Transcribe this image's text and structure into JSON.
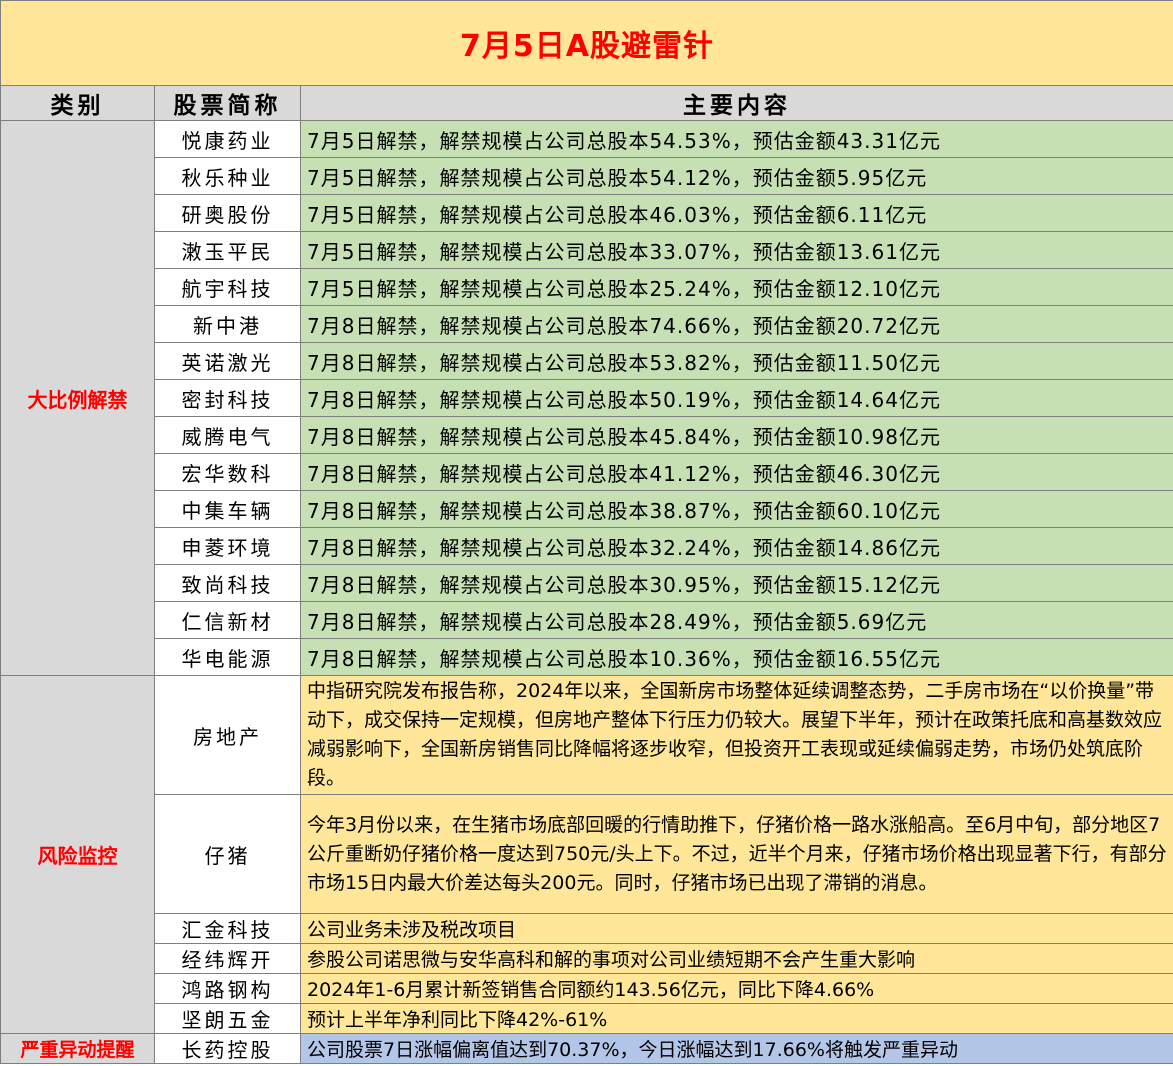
{
  "title": "7月5日A股避雷针",
  "headers": {
    "category": "类别",
    "stock": "股票简称",
    "content": "主要内容"
  },
  "sections": {
    "unlock": {
      "category": "大比例解禁",
      "rows": [
        {
          "name": "悦康药业",
          "content": "7月5日解禁，解禁规模占公司总股本54.53%，预估金额43.31亿元"
        },
        {
          "name": "秋乐种业",
          "content": "7月5日解禁，解禁规模占公司总股本54.12%，预估金额5.95亿元"
        },
        {
          "name": "研奥股份",
          "content": "7月5日解禁，解禁规模占公司总股本46.03%，预估金额6.11亿元"
        },
        {
          "name": "潄玉平民",
          "content": "7月5日解禁，解禁规模占公司总股本33.07%，预估金额13.61亿元"
        },
        {
          "name": "航宇科技",
          "content": "7月5日解禁，解禁规模占公司总股本25.24%，预估金额12.10亿元"
        },
        {
          "name": "新中港",
          "content": "7月8日解禁，解禁规模占公司总股本74.66%，预估金额20.72亿元"
        },
        {
          "name": "英诺激光",
          "content": "7月8日解禁，解禁规模占公司总股本53.82%，预估金额11.50亿元"
        },
        {
          "name": "密封科技",
          "content": "7月8日解禁，解禁规模占公司总股本50.19%，预估金额14.64亿元"
        },
        {
          "name": "威腾电气",
          "content": "7月8日解禁，解禁规模占公司总股本45.84%，预估金额10.98亿元"
        },
        {
          "name": "宏华数科",
          "content": "7月8日解禁，解禁规模占公司总股本41.12%，预估金额46.30亿元"
        },
        {
          "name": "中集车辆",
          "content": "7月8日解禁，解禁规模占公司总股本38.87%，预估金额60.10亿元"
        },
        {
          "name": "申菱环境",
          "content": "7月8日解禁，解禁规模占公司总股本32.24%，预估金额14.86亿元"
        },
        {
          "name": "致尚科技",
          "content": "7月8日解禁，解禁规模占公司总股本30.95%，预估金额15.12亿元"
        },
        {
          "name": "仁信新材",
          "content": "7月8日解禁，解禁规模占公司总股本28.49%，预估金额5.69亿元"
        },
        {
          "name": "华电能源",
          "content": "7月8日解禁，解禁规模占公司总股本10.36%，预估金额16.55亿元"
        }
      ]
    },
    "risk": {
      "category": "风险监控",
      "rows": [
        {
          "name": "房地产",
          "content": "中指研究院发布报告称，2024年以来，全国新房市场整体延续调整态势，二手房市场在“以价换量”带动下，成交保持一定规模，但房地产整体下行压力仍较大。展望下半年，预计在政策托底和高基数效应减弱影响下，全国新房销售同比降幅将逐步收窄，但投资开工表现或延续偏弱走势，市场仍处筑底阶段。"
        },
        {
          "name": "仔猪",
          "content": "今年3月份以来，在生猪市场底部回暖的行情助推下，仔猪价格一路水涨船高。至6月中旬，部分地区7公斤重断奶仔猪价格一度达到750元/头上下。不过，近半个月来，仔猪市场价格出现显著下行，有部分市场15日内最大价差达每头200元。同时，仔猪市场已出现了滞销的消息。"
        },
        {
          "name": "汇金科技",
          "content": "公司业务未涉及税改项目"
        },
        {
          "name": "经纬辉开",
          "content": "参股公司诺思微与安华高科和解的事项对公司业绩短期不会产生重大影响"
        },
        {
          "name": "鸿路钢构",
          "content": "2024年1-6月累计新签销售合同额约143.56亿元，同比下降4.66%"
        },
        {
          "name": "坚朗五金",
          "content": "预计上半年净利同比下降42%-61%"
        }
      ]
    },
    "abnormal": {
      "category": "严重异动提醒",
      "rows": [
        {
          "name": "长药控股",
          "content": "公司股票7日涨幅偏离值达到70.37%，今日涨幅达到17.66%将触发严重异动"
        }
      ]
    }
  },
  "colors": {
    "title_bg": "#ffe699",
    "title_text": "#ff0000",
    "green": "#c6e0b4",
    "yellow": "#ffe699",
    "blue": "#b4c6e7",
    "gray": "#d9d9d9"
  }
}
